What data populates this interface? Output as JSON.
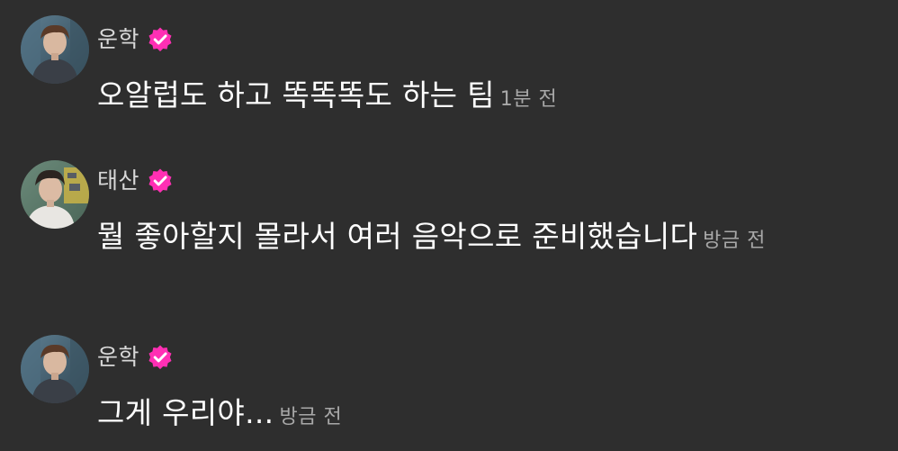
{
  "messages": [
    {
      "sender": "운학",
      "verified": true,
      "text": "오알럽도 하고 똑똑똑도 하는 팀",
      "time": "1분 전"
    },
    {
      "sender": "태산",
      "verified": true,
      "text": "뭘 좋아할지 몰라서 여러 음악으로 준비했습니다",
      "time": "방금 전"
    },
    {
      "sender": "운학",
      "verified": true,
      "text": "그게 우리야...",
      "time": "방금 전"
    }
  ],
  "colors": {
    "background": "#2e2e2e",
    "badge": "#ff2fb4",
    "name": "#d8d8d8",
    "time": "#a8a8a8"
  },
  "icons": {
    "verified": "verified-badge-icon",
    "avatar": "user-avatar-photo"
  }
}
